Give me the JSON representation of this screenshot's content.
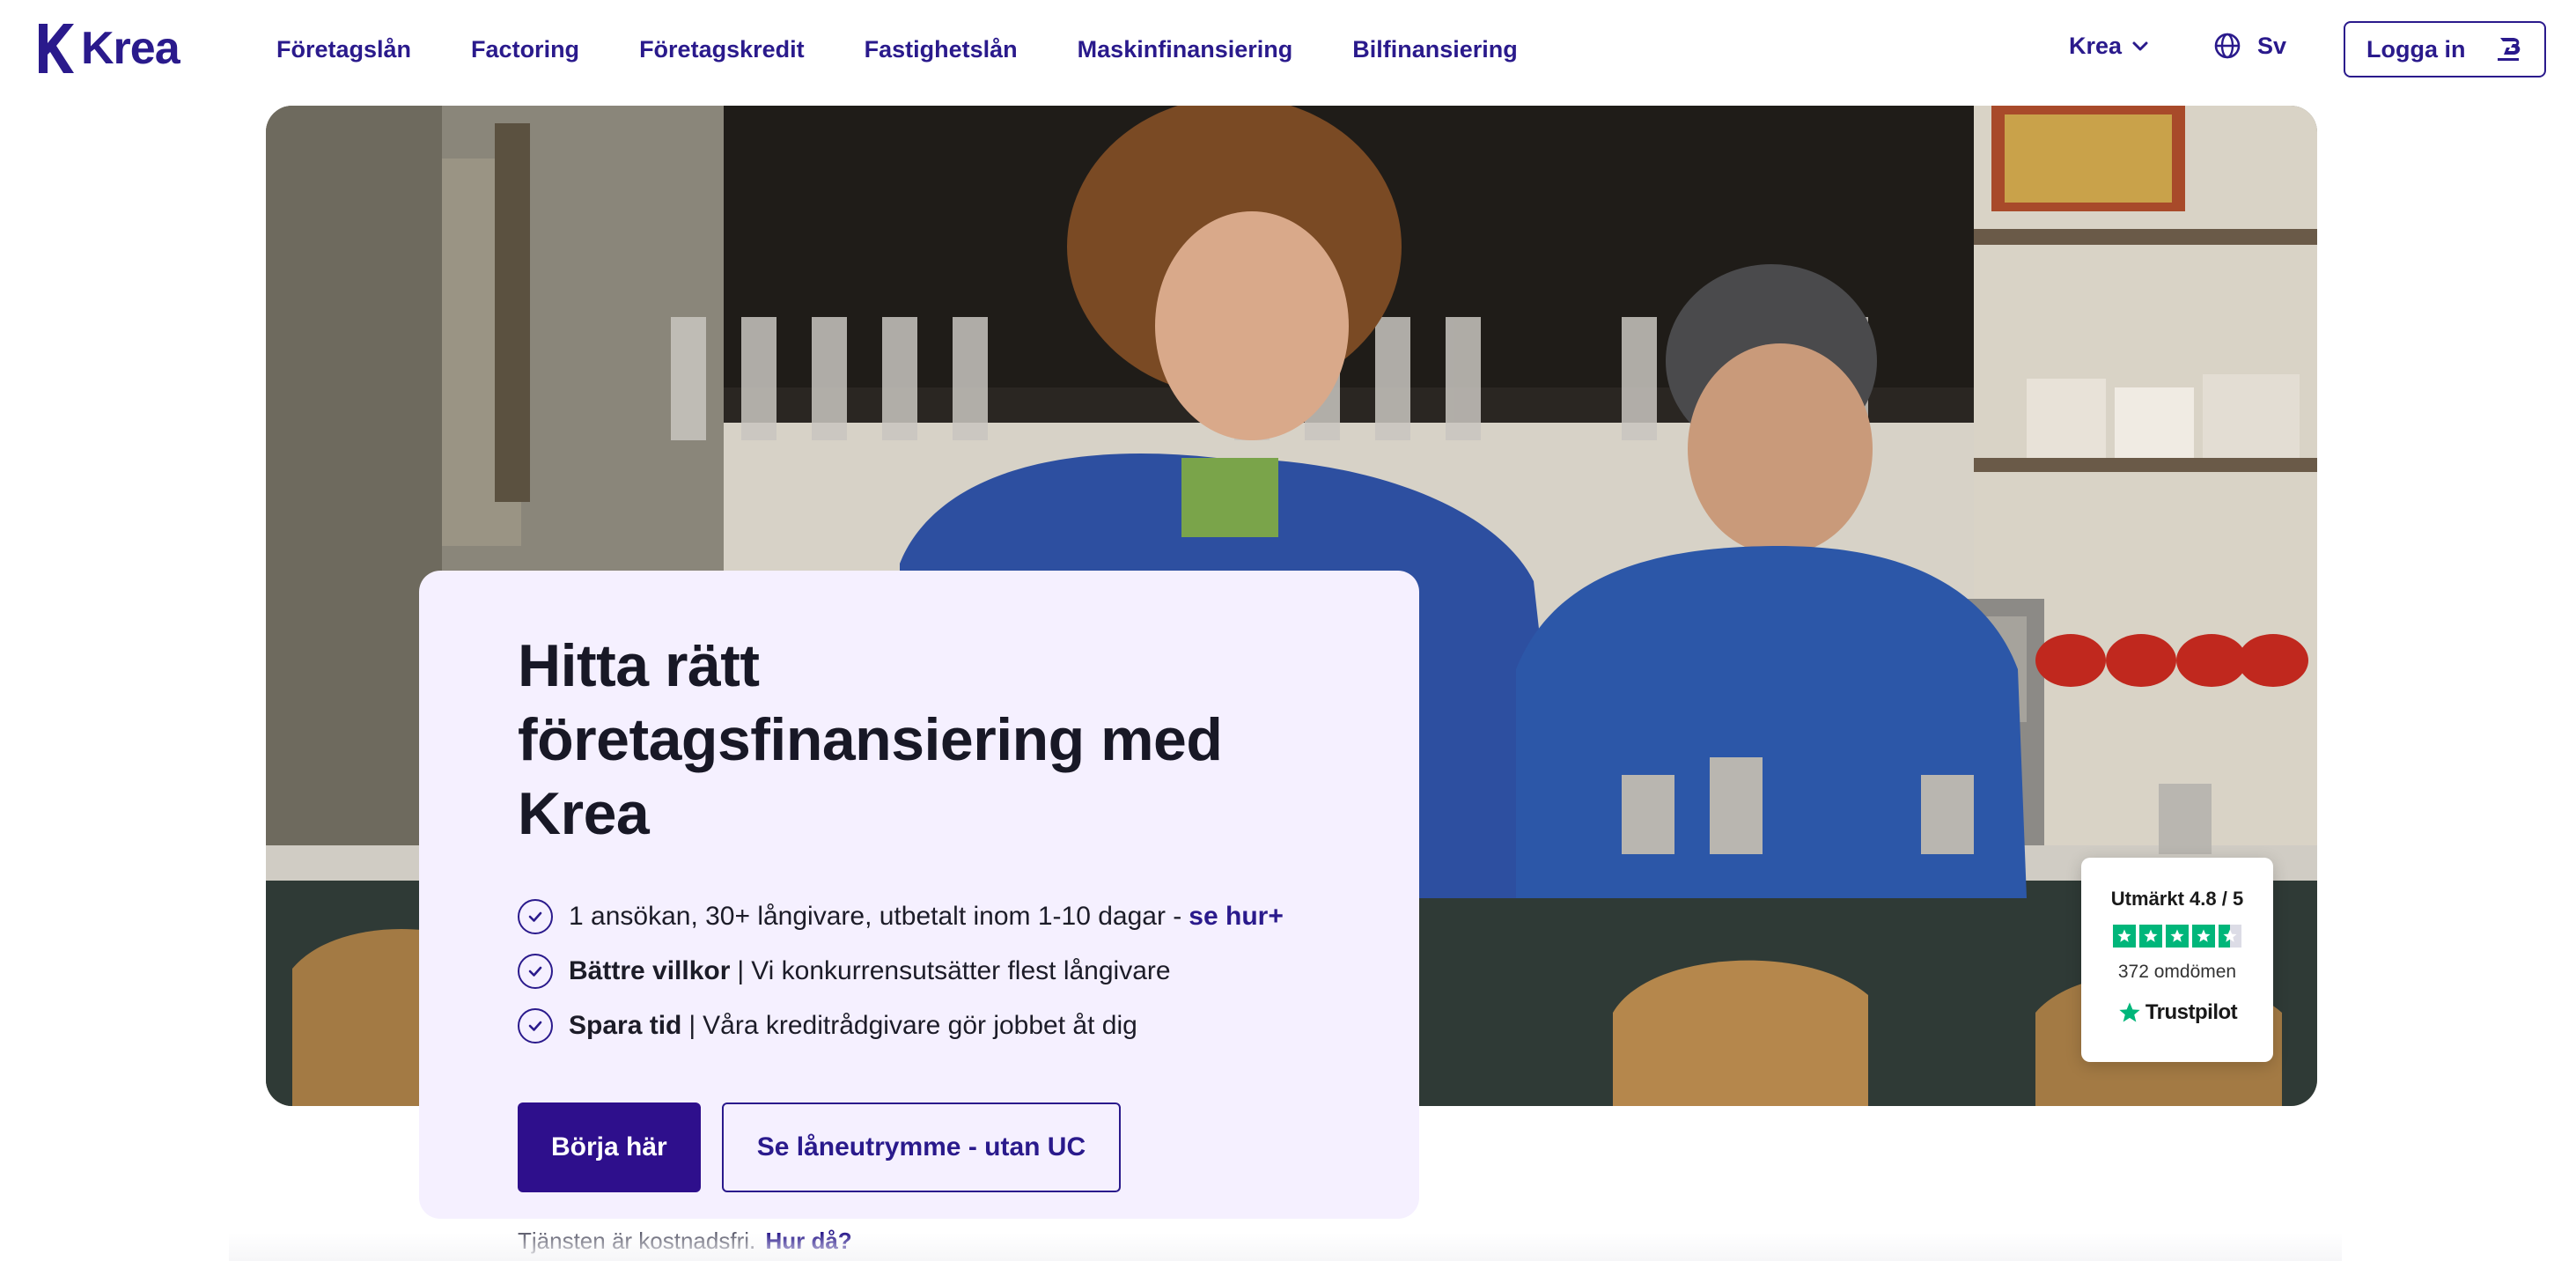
{
  "brand": {
    "name": "Krea",
    "color": "#2a1a8c"
  },
  "nav": {
    "links": [
      {
        "label": "Företagslån"
      },
      {
        "label": "Factoring"
      },
      {
        "label": "Företagskredit"
      },
      {
        "label": "Fastighetslån"
      },
      {
        "label": "Maskinfinansiering"
      },
      {
        "label": "Bilfinansiering"
      }
    ],
    "company_menu": "Krea",
    "language": "Sv",
    "login_label": "Logga in"
  },
  "hero": {
    "title": "Hitta rätt företagsfinansiering med Krea",
    "benefits": [
      {
        "bold": "",
        "text": "1 ansökan, 30+ långivare, utbetalt inom 1-10 dagar -",
        "link": "se hur+"
      },
      {
        "bold": "Bättre villkor",
        "sep": "|",
        "text": "Vi konkurrensutsätter flest långivare",
        "link": ""
      },
      {
        "bold": "Spara tid",
        "sep": "|",
        "text": "Våra kreditrådgivare gör jobbet åt dig",
        "link": ""
      }
    ],
    "primary_cta": "Börja här",
    "secondary_cta": "Se låneutrymme - utan UC",
    "free_note": "Tjänsten är kostnadsfri.",
    "free_note_link": "Hur då?"
  },
  "trustpilot": {
    "rating_text": "Utmärkt 4.8 / 5",
    "stars": 4.5,
    "reviews": "372 omdömen",
    "brand": "Trustpilot",
    "color": "#00b67a"
  },
  "icons": {
    "logo": "krea-logo-icon",
    "chevron": "chevron-down-icon",
    "globe": "globe-icon",
    "bankid": "bankid-icon",
    "check": "check-circle-icon",
    "star": "trustpilot-star-icon"
  }
}
